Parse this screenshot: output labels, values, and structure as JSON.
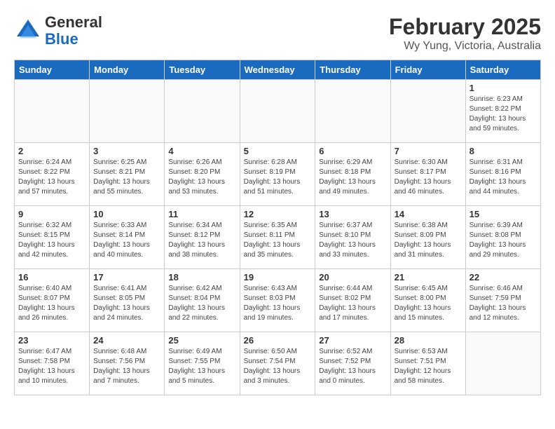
{
  "header": {
    "logo_line1": "General",
    "logo_line2": "Blue",
    "title": "February 2025",
    "subtitle": "Wy Yung, Victoria, Australia"
  },
  "calendar": {
    "headers": [
      "Sunday",
      "Monday",
      "Tuesday",
      "Wednesday",
      "Thursday",
      "Friday",
      "Saturday"
    ],
    "weeks": [
      [
        {
          "day": "",
          "info": ""
        },
        {
          "day": "",
          "info": ""
        },
        {
          "day": "",
          "info": ""
        },
        {
          "day": "",
          "info": ""
        },
        {
          "day": "",
          "info": ""
        },
        {
          "day": "",
          "info": ""
        },
        {
          "day": "1",
          "info": "Sunrise: 6:23 AM\nSunset: 8:22 PM\nDaylight: 13 hours and 59 minutes."
        }
      ],
      [
        {
          "day": "2",
          "info": "Sunrise: 6:24 AM\nSunset: 8:22 PM\nDaylight: 13 hours and 57 minutes."
        },
        {
          "day": "3",
          "info": "Sunrise: 6:25 AM\nSunset: 8:21 PM\nDaylight: 13 hours and 55 minutes."
        },
        {
          "day": "4",
          "info": "Sunrise: 6:26 AM\nSunset: 8:20 PM\nDaylight: 13 hours and 53 minutes."
        },
        {
          "day": "5",
          "info": "Sunrise: 6:28 AM\nSunset: 8:19 PM\nDaylight: 13 hours and 51 minutes."
        },
        {
          "day": "6",
          "info": "Sunrise: 6:29 AM\nSunset: 8:18 PM\nDaylight: 13 hours and 49 minutes."
        },
        {
          "day": "7",
          "info": "Sunrise: 6:30 AM\nSunset: 8:17 PM\nDaylight: 13 hours and 46 minutes."
        },
        {
          "day": "8",
          "info": "Sunrise: 6:31 AM\nSunset: 8:16 PM\nDaylight: 13 hours and 44 minutes."
        }
      ],
      [
        {
          "day": "9",
          "info": "Sunrise: 6:32 AM\nSunset: 8:15 PM\nDaylight: 13 hours and 42 minutes."
        },
        {
          "day": "10",
          "info": "Sunrise: 6:33 AM\nSunset: 8:14 PM\nDaylight: 13 hours and 40 minutes."
        },
        {
          "day": "11",
          "info": "Sunrise: 6:34 AM\nSunset: 8:12 PM\nDaylight: 13 hours and 38 minutes."
        },
        {
          "day": "12",
          "info": "Sunrise: 6:35 AM\nSunset: 8:11 PM\nDaylight: 13 hours and 35 minutes."
        },
        {
          "day": "13",
          "info": "Sunrise: 6:37 AM\nSunset: 8:10 PM\nDaylight: 13 hours and 33 minutes."
        },
        {
          "day": "14",
          "info": "Sunrise: 6:38 AM\nSunset: 8:09 PM\nDaylight: 13 hours and 31 minutes."
        },
        {
          "day": "15",
          "info": "Sunrise: 6:39 AM\nSunset: 8:08 PM\nDaylight: 13 hours and 29 minutes."
        }
      ],
      [
        {
          "day": "16",
          "info": "Sunrise: 6:40 AM\nSunset: 8:07 PM\nDaylight: 13 hours and 26 minutes."
        },
        {
          "day": "17",
          "info": "Sunrise: 6:41 AM\nSunset: 8:05 PM\nDaylight: 13 hours and 24 minutes."
        },
        {
          "day": "18",
          "info": "Sunrise: 6:42 AM\nSunset: 8:04 PM\nDaylight: 13 hours and 22 minutes."
        },
        {
          "day": "19",
          "info": "Sunrise: 6:43 AM\nSunset: 8:03 PM\nDaylight: 13 hours and 19 minutes."
        },
        {
          "day": "20",
          "info": "Sunrise: 6:44 AM\nSunset: 8:02 PM\nDaylight: 13 hours and 17 minutes."
        },
        {
          "day": "21",
          "info": "Sunrise: 6:45 AM\nSunset: 8:00 PM\nDaylight: 13 hours and 15 minutes."
        },
        {
          "day": "22",
          "info": "Sunrise: 6:46 AM\nSunset: 7:59 PM\nDaylight: 13 hours and 12 minutes."
        }
      ],
      [
        {
          "day": "23",
          "info": "Sunrise: 6:47 AM\nSunset: 7:58 PM\nDaylight: 13 hours and 10 minutes."
        },
        {
          "day": "24",
          "info": "Sunrise: 6:48 AM\nSunset: 7:56 PM\nDaylight: 13 hours and 7 minutes."
        },
        {
          "day": "25",
          "info": "Sunrise: 6:49 AM\nSunset: 7:55 PM\nDaylight: 13 hours and 5 minutes."
        },
        {
          "day": "26",
          "info": "Sunrise: 6:50 AM\nSunset: 7:54 PM\nDaylight: 13 hours and 3 minutes."
        },
        {
          "day": "27",
          "info": "Sunrise: 6:52 AM\nSunset: 7:52 PM\nDaylight: 13 hours and 0 minutes."
        },
        {
          "day": "28",
          "info": "Sunrise: 6:53 AM\nSunset: 7:51 PM\nDaylight: 12 hours and 58 minutes."
        },
        {
          "day": "",
          "info": ""
        }
      ]
    ]
  }
}
